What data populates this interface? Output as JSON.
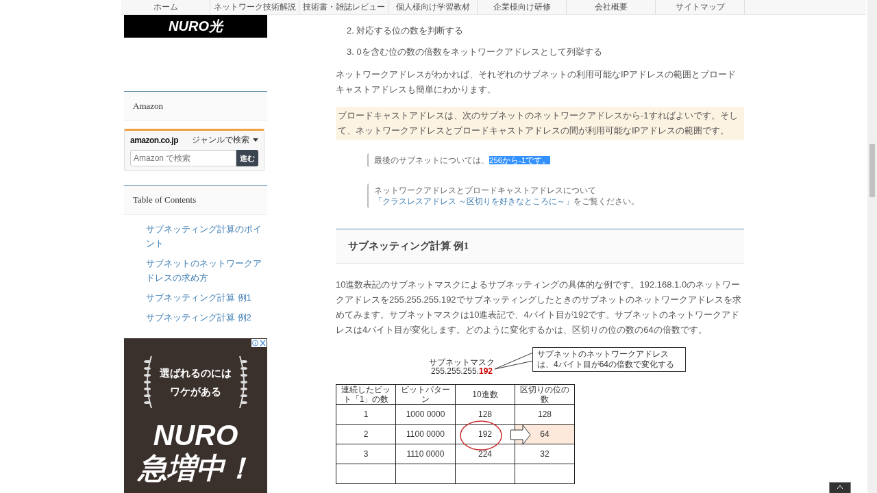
{
  "nav": {
    "items": [
      "ホーム",
      "ネットワーク技術解説",
      "技術書・雑誌レビュー",
      "個人様向け学習教材",
      "企業様向け研修",
      "会社概要",
      "サイトマップ"
    ]
  },
  "sidebar": {
    "logo": "NURO光",
    "amazon": {
      "title": "Amazon",
      "logo": "amazon.co.jp",
      "genre": "ジャンルで検索",
      "placeholder": "Amazon で検索",
      "button": "進む"
    },
    "toc": {
      "title": "Table of Contents",
      "items": [
        "サブネッティング計算のポイント",
        "サブネットのネットワークアドレスの求め方",
        "サブネッティング計算 例1",
        "サブネッティング計算 例2"
      ]
    },
    "ad": {
      "tagline": [
        "選ばれるのには",
        "ワケがある"
      ],
      "headline": [
        "NURO",
        "急増中！"
      ]
    }
  },
  "main": {
    "steps": [
      {
        "number": "2.",
        "text": "対応する位の数を判断する"
      },
      {
        "number": "3.",
        "text": "0を含む位の数の倍数をネットワークアドレスとして列挙する"
      }
    ],
    "paragraph_1": "ネットワークアドレスがわかれば、それぞれのサブネットの利用可能なIPアドレスの範囲とブロードキャストアドレスも簡単にわかります。",
    "highlight_paragraph": "ブロードキャストアドレスは、次のサブネットのネットワークアドレスから-1すればよいです。そして、ネットワークアドレスとブロードキャストアドレスの間が利用可能なIPアドレスの範囲です。",
    "quotes": [
      {
        "text": "最後のサブネットについては、",
        "selected_text": "256から-1です。"
      },
      {
        "text": "ネットワークアドレスとブロードキャストアドレスについて",
        "link": "「クラスレスアドレス ～区切りを好きなところに～」",
        "after": "をご覧ください。"
      }
    ],
    "heading": "サブネッティング計算 例1",
    "paragraph_2": "10進数表記のサブネットマスクによるサブネッティングの具体的な例です。192.168.1.0のネットワークアドレスを255.255.255.192でサブネッティングしたときのサブネットのネットワークアドレスを求めてみます。サブネットマスクは10進表記で、4バイト目が192です。サブネットのネットワークアドレスは4バイト目が変化します。どのように変化するかは、区切りの位の数の64の倍数です。",
    "figure": {
      "mask_label": "サブネットマスク",
      "mask_prefix": "255.255.255.",
      "mask_last": "192",
      "callout": "サブネットのネットワークアドレスは、4バイト目が64の倍数で変化する",
      "columns": [
        "連続したビット「1」の数",
        "ビットパターン",
        "10進数",
        "区切りの位の数"
      ],
      "rows": [
        {
          "cells": [
            "1",
            "1000 0000",
            "128",
            "128"
          ],
          "emphasis": false
        },
        {
          "cells": [
            "2",
            "1100 0000",
            "192",
            "64"
          ],
          "emphasis": true
        },
        {
          "cells": [
            "3",
            "1110 0000",
            "224",
            "32"
          ],
          "emphasis": false
        }
      ]
    }
  }
}
